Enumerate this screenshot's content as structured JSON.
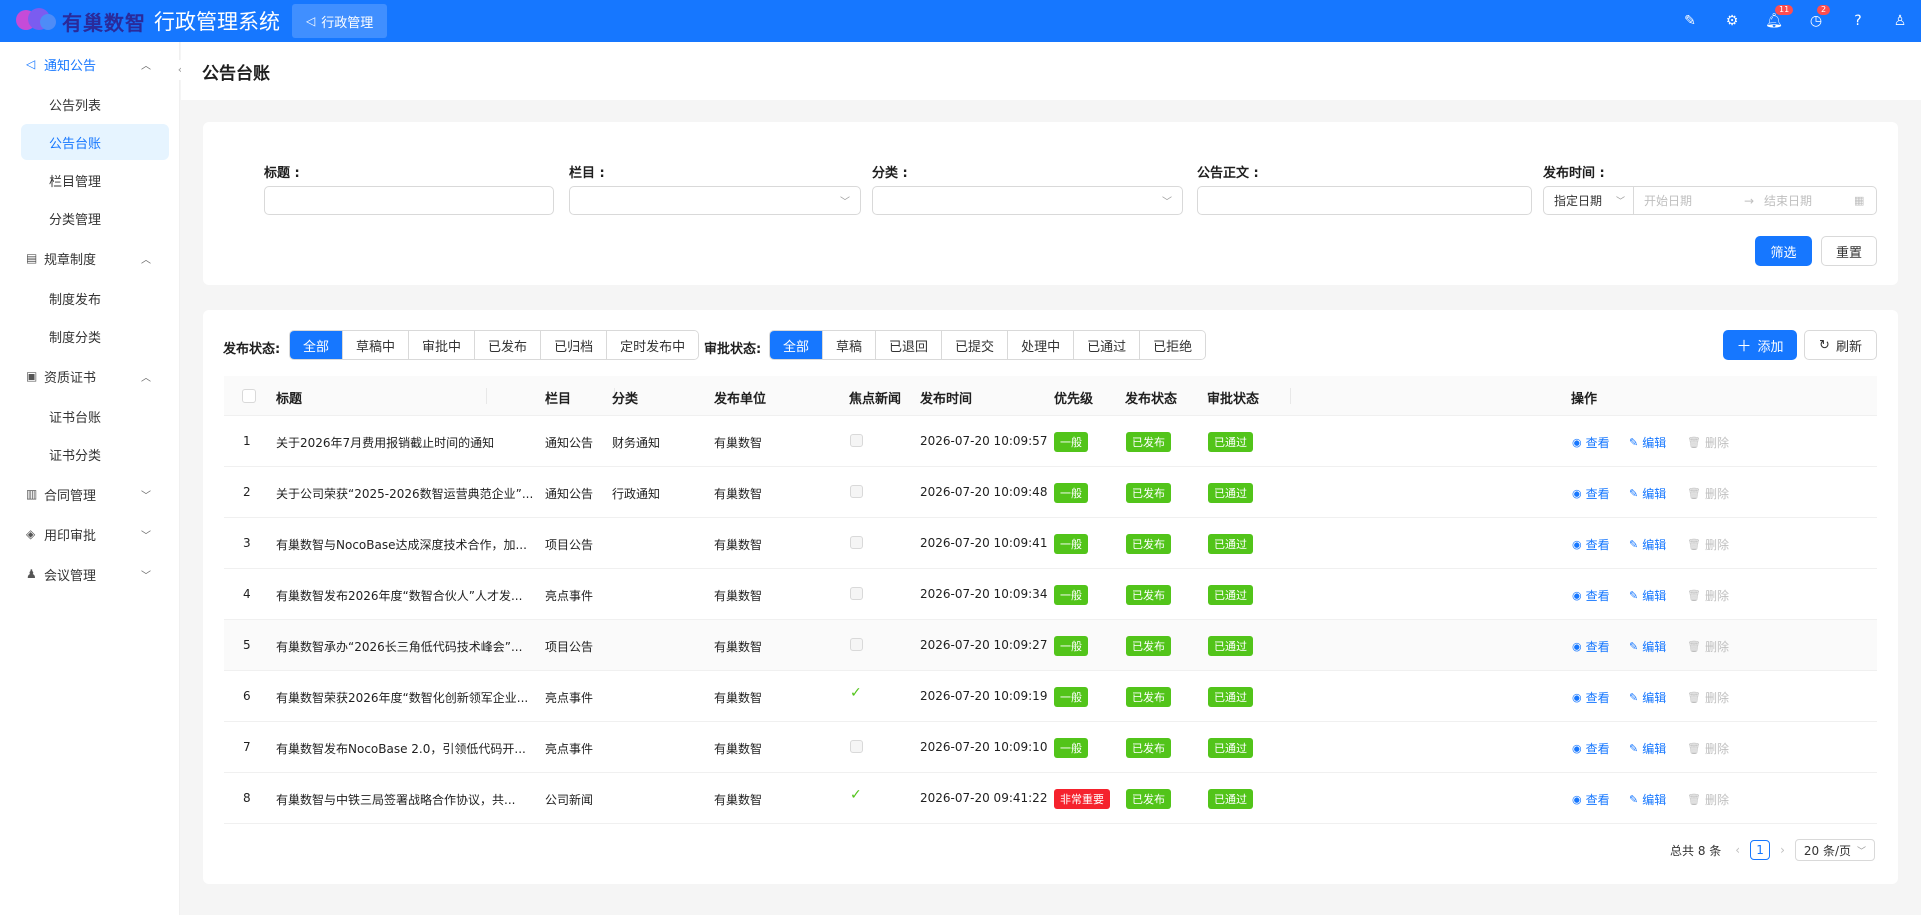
{
  "header": {
    "logo_text": "有巢数智",
    "system_title": "行政管理系统",
    "top_tab": "行政管理",
    "notification_badge": "11",
    "todo_badge": "2"
  },
  "sidebar": {
    "groups": [
      {
        "label": "通知公告",
        "items": [
          "公告列表",
          "公告台账",
          "栏目管理",
          "分类管理"
        ]
      },
      {
        "label": "规章制度",
        "items": [
          "制度发布",
          "制度分类"
        ]
      },
      {
        "label": "资质证书",
        "items": [
          "证书台账",
          "证书分类"
        ]
      },
      {
        "label": "合同管理"
      },
      {
        "label": "用印审批"
      },
      {
        "label": "会议管理"
      }
    ]
  },
  "page": {
    "title": "公告台账"
  },
  "filters": {
    "title_label": "标题 :",
    "column_label": "栏目 :",
    "category_label": "分类 :",
    "body_label": "公告正文 :",
    "time_label": "发布时间 :",
    "date_mode": "指定日期",
    "start_placeholder": "开始日期",
    "end_placeholder": "结束日期",
    "arrow": "→",
    "filter_button": "筛选",
    "reset_button": "重置"
  },
  "toolbar": {
    "publish_status_label": "发布状态:",
    "publish_status": [
      "全部",
      "草稿中",
      "审批中",
      "已发布",
      "已归档",
      "定时发布中"
    ],
    "approval_status_label": "审批状态:",
    "approval_status": [
      "全部",
      "草稿",
      "已退回",
      "已提交",
      "处理中",
      "已通过",
      "已拒绝"
    ],
    "add_button": "添加",
    "refresh_button": "刷新"
  },
  "table": {
    "headers": {
      "title": "标题",
      "column": "栏目",
      "category": "分类",
      "unit": "发布单位",
      "focus": "焦点新闻",
      "time": "发布时间",
      "priority": "优先级",
      "publish_status": "发布状态",
      "approval_status": "审批状态",
      "actions": "操作"
    },
    "actions": {
      "view": "查看",
      "edit": "编辑",
      "delete": "删除"
    },
    "rows": [
      {
        "no": "1",
        "title": "关于2026年7月费用报销截止时间的通知",
        "column": "通知公告",
        "category": "财务通知",
        "unit": "有巢数智",
        "focus": false,
        "time": "2026-07-20 10:09:57",
        "priority": "一般",
        "publish_status": "已发布",
        "approval_status": "已通过"
      },
      {
        "no": "2",
        "title": "关于公司荣获“2025-2026数智运营典范企业”...",
        "column": "通知公告",
        "category": "行政通知",
        "unit": "有巢数智",
        "focus": false,
        "time": "2026-07-20 10:09:48",
        "priority": "一般",
        "publish_status": "已发布",
        "approval_status": "已通过"
      },
      {
        "no": "3",
        "title": "有巢数智与NocoBase达成深度技术合作，加...",
        "column": "项目公告",
        "category": "",
        "unit": "有巢数智",
        "focus": false,
        "time": "2026-07-20 10:09:41",
        "priority": "一般",
        "publish_status": "已发布",
        "approval_status": "已通过"
      },
      {
        "no": "4",
        "title": "有巢数智发布2026年度“数智合伙人”人才发...",
        "column": "亮点事件",
        "category": "",
        "unit": "有巢数智",
        "focus": false,
        "time": "2026-07-20 10:09:34",
        "priority": "一般",
        "publish_status": "已发布",
        "approval_status": "已通过"
      },
      {
        "no": "5",
        "title": "有巢数智承办“2026长三角低代码技术峰会”...",
        "column": "项目公告",
        "category": "",
        "unit": "有巢数智",
        "focus": false,
        "time": "2026-07-20 10:09:27",
        "priority": "一般",
        "publish_status": "已发布",
        "approval_status": "已通过"
      },
      {
        "no": "6",
        "title": "有巢数智荣获2026年度“数智化创新领军企业...",
        "column": "亮点事件",
        "category": "",
        "unit": "有巢数智",
        "focus": true,
        "time": "2026-07-20 10:09:19",
        "priority": "一般",
        "publish_status": "已发布",
        "approval_status": "已通过"
      },
      {
        "no": "7",
        "title": "有巢数智发布NocoBase 2.0，引领低代码开...",
        "column": "亮点事件",
        "category": "",
        "unit": "有巢数智",
        "focus": false,
        "time": "2026-07-20 10:09:10",
        "priority": "一般",
        "publish_status": "已发布",
        "approval_status": "已通过"
      },
      {
        "no": "8",
        "title": "有巢数智与中铁三局签署战略合作协议，共...",
        "column": "公司新闻",
        "category": "",
        "unit": "有巢数智",
        "focus": true,
        "time": "2026-07-20 09:41:22",
        "priority": "非常重要",
        "publish_status": "已发布",
        "approval_status": "已通过"
      }
    ]
  },
  "pagination": {
    "total": "总共 8 条",
    "current": "1",
    "page_size": "20 条/页"
  },
  "colors": {
    "primary": "#1677ff",
    "success": "#52c41a",
    "danger": "#f5222d"
  }
}
